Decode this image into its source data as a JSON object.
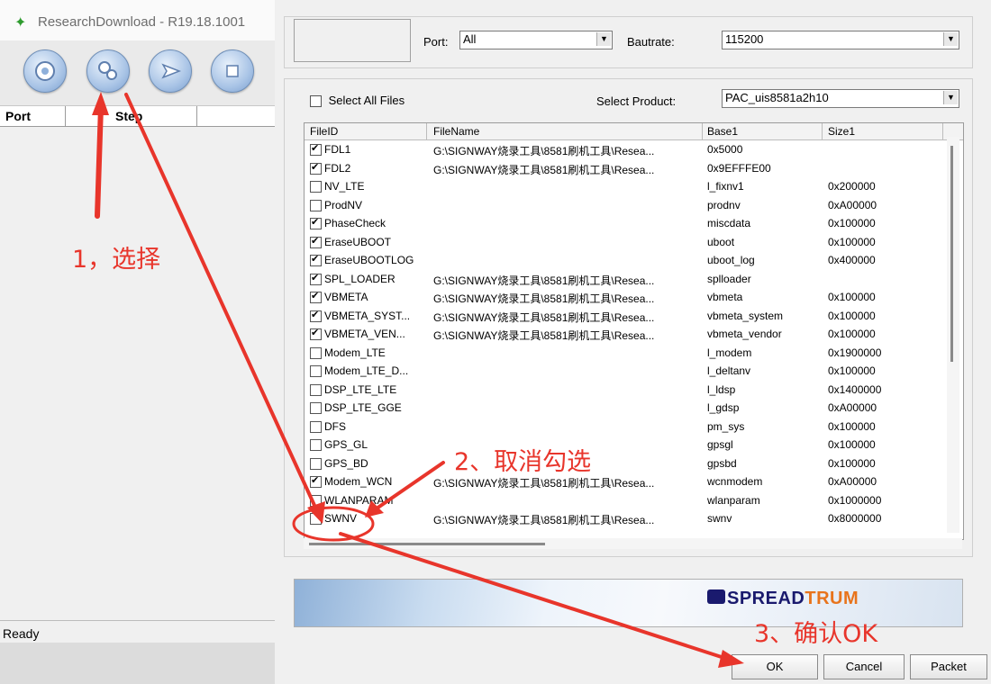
{
  "main_window": {
    "title": "ResearchDownload - R19.18.1001",
    "toolbar": [
      {
        "name": "load-packet-button",
        "icon": "gear-icon"
      },
      {
        "name": "settings-button",
        "icon": "gears-icon"
      },
      {
        "name": "start-download-button",
        "icon": "play-icon"
      },
      {
        "name": "stop-download-button",
        "icon": "stop-icon"
      }
    ],
    "columns": [
      "Port",
      "Step"
    ],
    "status": "Ready"
  },
  "dialog": {
    "port_label": "Port:",
    "port_value": "All",
    "baudrate_label": "Bautrate:",
    "baudrate_value": "115200",
    "select_all_label": "Select All Files",
    "select_product_label": "Select Product:",
    "product_value": "PAC_uis8581a2h10",
    "table_headers": [
      "FileID",
      "FileName",
      "Base1",
      "Size1"
    ],
    "rows": [
      {
        "id": "FDL1",
        "checked": true,
        "file": "G:\\SIGNWAY烧录工具\\8581刷机工具\\Resea...",
        "base": "0x5000",
        "size": ""
      },
      {
        "id": "FDL2",
        "checked": true,
        "file": "G:\\SIGNWAY烧录工具\\8581刷机工具\\Resea...",
        "base": "0x9EFFFE00",
        "size": ""
      },
      {
        "id": "NV_LTE",
        "checked": false,
        "file": "",
        "base": "l_fixnv1",
        "size": "0x200000"
      },
      {
        "id": "ProdNV",
        "checked": false,
        "file": "",
        "base": "prodnv",
        "size": "0xA00000"
      },
      {
        "id": "PhaseCheck",
        "checked": true,
        "file": "",
        "base": "miscdata",
        "size": "0x100000"
      },
      {
        "id": "EraseUBOOT",
        "checked": true,
        "file": "",
        "base": "uboot",
        "size": "0x100000"
      },
      {
        "id": "EraseUBOOTLOG",
        "checked": true,
        "file": "",
        "base": "uboot_log",
        "size": "0x400000"
      },
      {
        "id": "SPL_LOADER",
        "checked": true,
        "file": "G:\\SIGNWAY烧录工具\\8581刷机工具\\Resea...",
        "base": "splloader",
        "size": ""
      },
      {
        "id": "VBMETA",
        "checked": true,
        "file": "G:\\SIGNWAY烧录工具\\8581刷机工具\\Resea...",
        "base": "vbmeta",
        "size": "0x100000"
      },
      {
        "id": "VBMETA_SYST...",
        "checked": true,
        "file": "G:\\SIGNWAY烧录工具\\8581刷机工具\\Resea...",
        "base": "vbmeta_system",
        "size": "0x100000"
      },
      {
        "id": "VBMETA_VEN...",
        "checked": true,
        "file": "G:\\SIGNWAY烧录工具\\8581刷机工具\\Resea...",
        "base": "vbmeta_vendor",
        "size": "0x100000"
      },
      {
        "id": "Modem_LTE",
        "checked": false,
        "file": "",
        "base": "l_modem",
        "size": "0x1900000"
      },
      {
        "id": "Modem_LTE_D...",
        "checked": false,
        "file": "",
        "base": "l_deltanv",
        "size": "0x100000"
      },
      {
        "id": "DSP_LTE_LTE",
        "checked": false,
        "file": "",
        "base": "l_ldsp",
        "size": "0x1400000"
      },
      {
        "id": "DSP_LTE_GGE",
        "checked": false,
        "file": "",
        "base": "l_gdsp",
        "size": "0xA00000"
      },
      {
        "id": "DFS",
        "checked": false,
        "file": "",
        "base": "pm_sys",
        "size": "0x100000"
      },
      {
        "id": "GPS_GL",
        "checked": false,
        "file": "",
        "base": "gpsgl",
        "size": "0x100000"
      },
      {
        "id": "GPS_BD",
        "checked": false,
        "file": "",
        "base": "gpsbd",
        "size": "0x100000"
      },
      {
        "id": "Modem_WCN",
        "checked": true,
        "file": "G:\\SIGNWAY烧录工具\\8581刷机工具\\Resea...",
        "base": "wcnmodem",
        "size": "0xA00000"
      },
      {
        "id": "WLANPARAM",
        "checked": false,
        "file": "",
        "base": "wlanparam",
        "size": "0x1000000"
      },
      {
        "id": "SWNV",
        "checked": false,
        "file": "G:\\SIGNWAY烧录工具\\8581刷机工具\\Resea...",
        "base": "swnv",
        "size": "0x8000000"
      }
    ],
    "banner_logo_part1": "SPREAD",
    "banner_logo_part2": "TRUM",
    "buttons": {
      "ok": "OK",
      "cancel": "Cancel",
      "packet": "Packet"
    }
  },
  "annotations": {
    "step1": "1，选择",
    "step2": "2、取消勾选",
    "step3": "3、确认OK",
    "color": "#e8352b"
  }
}
